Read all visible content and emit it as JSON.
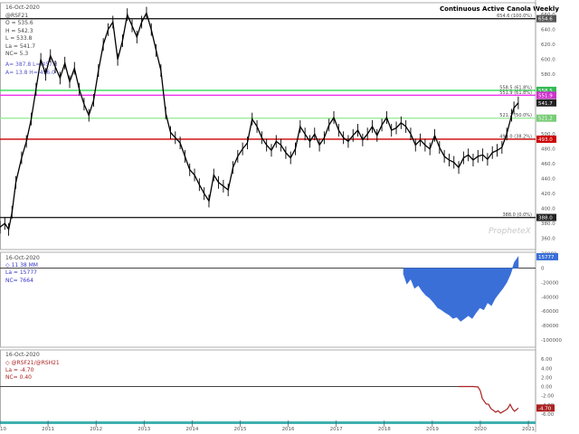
{
  "title": "Continuous Active Canola Weekly",
  "watermark": "PropheteX",
  "colors": {
    "price": "#000000",
    "resistance_red": "#cc0000",
    "line_green": "#33dd55",
    "line_light_green": "#99ee99",
    "line_magenta": "#ee33ee",
    "net_fill": "#3a6fd8",
    "ratio_line": "#aa2222",
    "grid_gray": "#888888",
    "time_axis_teal": "#40b0b0"
  },
  "panels": {
    "top": {
      "date": "16-Oct-2020",
      "symbol": "@RSF21",
      "readouts": [
        "O = 535.6",
        "H = 542.3",
        "L = 533.8",
        "La = 541.7",
        "NC= 5.3"
      ],
      "fib_notes": [
        "A= 387.8 L= 457.3",
        "A= 13.8 H= 496.0"
      ]
    },
    "middle": {
      "date": "16-Oct-2020",
      "readouts": [
        "◇ 11 38 MM",
        "La = 15777",
        "NC= 7664"
      ]
    },
    "bottom": {
      "date": "16-Oct-2020",
      "readouts": [
        "◇ @RSF21/@RSH21",
        "La = -4.70",
        "NC= 0.40"
      ]
    }
  },
  "chart_data": [
    {
      "type": "line",
      "title": "Continuous Active Canola Weekly",
      "x_ticks": [
        "2010",
        "2011",
        "2012",
        "2013",
        "2014",
        "2015",
        "2016",
        "2017",
        "2018",
        "2019",
        "2020",
        "2021"
      ],
      "y_ticks": [
        360.0,
        380.0,
        400.0,
        420.0,
        440.0,
        460.0,
        480.0,
        500.0,
        520.0,
        540.0,
        560.0,
        580.0,
        600.0,
        620.0,
        640.0,
        660.0
      ],
      "ylim": [
        345,
        676
      ],
      "xlim": [
        2010.0,
        2021.15
      ],
      "series": [
        {
          "x": [
            2010.0,
            2010.1,
            2010.18,
            2010.25,
            2010.33,
            2010.45,
            2010.55,
            2010.65,
            2010.75,
            2010.85,
            2010.95,
            2011.05,
            2011.15,
            2011.25,
            2011.35,
            2011.45,
            2011.55,
            2011.65,
            2011.75,
            2011.85,
            2011.95,
            2012.05,
            2012.15,
            2012.25,
            2012.35,
            2012.45,
            2012.55,
            2012.65,
            2012.75,
            2012.85,
            2012.95,
            2013.05,
            2013.15,
            2013.25,
            2013.35,
            2013.45,
            2013.55,
            2013.65,
            2013.75,
            2013.85,
            2013.95,
            2014.05,
            2014.15,
            2014.25,
            2014.35,
            2014.45,
            2014.55,
            2014.65,
            2014.75,
            2014.85,
            2014.95,
            2015.05,
            2015.15,
            2015.25,
            2015.35,
            2015.45,
            2015.55,
            2015.65,
            2015.75,
            2015.85,
            2015.95,
            2016.05,
            2016.15,
            2016.25,
            2016.35,
            2016.45,
            2016.55,
            2016.65,
            2016.75,
            2016.85,
            2016.95,
            2017.05,
            2017.15,
            2017.25,
            2017.35,
            2017.45,
            2017.55,
            2017.65,
            2017.75,
            2017.85,
            2017.95,
            2018.05,
            2018.15,
            2018.25,
            2018.35,
            2018.45,
            2018.55,
            2018.65,
            2018.75,
            2018.85,
            2018.95,
            2019.05,
            2019.15,
            2019.25,
            2019.35,
            2019.45,
            2019.55,
            2019.65,
            2019.75,
            2019.85,
            2019.95,
            2020.05,
            2020.15,
            2020.25,
            2020.35,
            2020.45,
            2020.55,
            2020.65,
            2020.7,
            2020.79
          ],
          "values": [
            375,
            380,
            372,
            395,
            435,
            468,
            490,
            520,
            560,
            600,
            580,
            605,
            590,
            575,
            595,
            570,
            588,
            560,
            540,
            525,
            545,
            585,
            620,
            640,
            650,
            600,
            625,
            660,
            645,
            630,
            650,
            662,
            640,
            612,
            585,
            528,
            502,
            495,
            488,
            470,
            452,
            445,
            432,
            420,
            410,
            445,
            435,
            430,
            425,
            455,
            470,
            480,
            488,
            520,
            510,
            495,
            485,
            478,
            490,
            485,
            475,
            468,
            480,
            510,
            500,
            490,
            500,
            485,
            495,
            512,
            522,
            505,
            495,
            490,
            498,
            505,
            492,
            500,
            510,
            498,
            512,
            522,
            505,
            508,
            515,
            510,
            500,
            485,
            492,
            485,
            480,
            498,
            482,
            470,
            465,
            462,
            455,
            468,
            472,
            465,
            470,
            472,
            466,
            475,
            478,
            482,
            500,
            525,
            535,
            541.7
          ]
        }
      ],
      "annotations": [
        {
          "value": 654.6,
          "label": "654.6 (100.0%)"
        },
        {
          "value": 558.5,
          "label": "558.5 (61.8%)"
        },
        {
          "value": 551.9,
          "label": "551.9 (61.8%)"
        },
        {
          "value": 521.2,
          "label": "521.2 (50.0%)"
        },
        {
          "value": 493.0,
          "label": "493.0 (38.2%)"
        },
        {
          "value": 388.0,
          "label": "388.0 (0.0%)"
        }
      ],
      "price_tags": [
        "654.6",
        "558.5",
        "551.9",
        "541.7",
        "521.2",
        "493.0",
        "388.0"
      ]
    },
    {
      "type": "area",
      "y_ticks": [
        0,
        -20000,
        -40000,
        -60000,
        -80000,
        -100000
      ],
      "top_tick": "20000",
      "ylim": [
        -110000,
        22000
      ],
      "latest_tag": "15777",
      "series": [
        {
          "x": [
            2018.4,
            2018.47,
            2018.55,
            2018.63,
            2018.71,
            2018.79,
            2018.87,
            2018.95,
            2019.03,
            2019.11,
            2019.19,
            2019.27,
            2019.35,
            2019.43,
            2019.51,
            2019.59,
            2019.67,
            2019.75,
            2019.83,
            2019.91,
            2019.99,
            2020.07,
            2020.15,
            2020.23,
            2020.31,
            2020.39,
            2020.47,
            2020.55,
            2020.63,
            2020.71,
            2020.79
          ],
          "values": [
            -8000,
            -22000,
            -15000,
            -28000,
            -24000,
            -32000,
            -38000,
            -42000,
            -48000,
            -55000,
            -58000,
            -62000,
            -65000,
            -70000,
            -68000,
            -74000,
            -70000,
            -66000,
            -70000,
            -62000,
            -55000,
            -58000,
            -48000,
            -52000,
            -42000,
            -35000,
            -28000,
            -20000,
            -8000,
            8000,
            15777
          ]
        }
      ]
    },
    {
      "type": "line",
      "y_ticks": [
        "6.00",
        "4.00",
        "2.00",
        "0.00",
        "-2.00",
        "-4.00",
        "-6.00"
      ],
      "y_tick_values": [
        6,
        4,
        2,
        0,
        -2,
        -4,
        -6
      ],
      "ylim": [
        -8,
        8
      ],
      "latest_tag": "-4.70",
      "series": [
        {
          "x": [
            2019.55,
            2019.65,
            2019.75,
            2019.85,
            2019.95,
            2020.0,
            2020.04,
            2020.08,
            2020.12,
            2020.17,
            2020.22,
            2020.27,
            2020.32,
            2020.37,
            2020.42,
            2020.47,
            2020.52,
            2020.57,
            2020.62,
            2020.67,
            2020.71,
            2020.75,
            2020.79
          ],
          "values": [
            0.0,
            0.0,
            0.0,
            0.0,
            -0.1,
            -0.9,
            -2.6,
            -3.2,
            -3.8,
            -3.9,
            -4.8,
            -5.2,
            -5.6,
            -5.3,
            -5.8,
            -5.5,
            -5.2,
            -4.8,
            -3.9,
            -4.9,
            -5.4,
            -5.1,
            -4.7
          ]
        }
      ]
    }
  ]
}
